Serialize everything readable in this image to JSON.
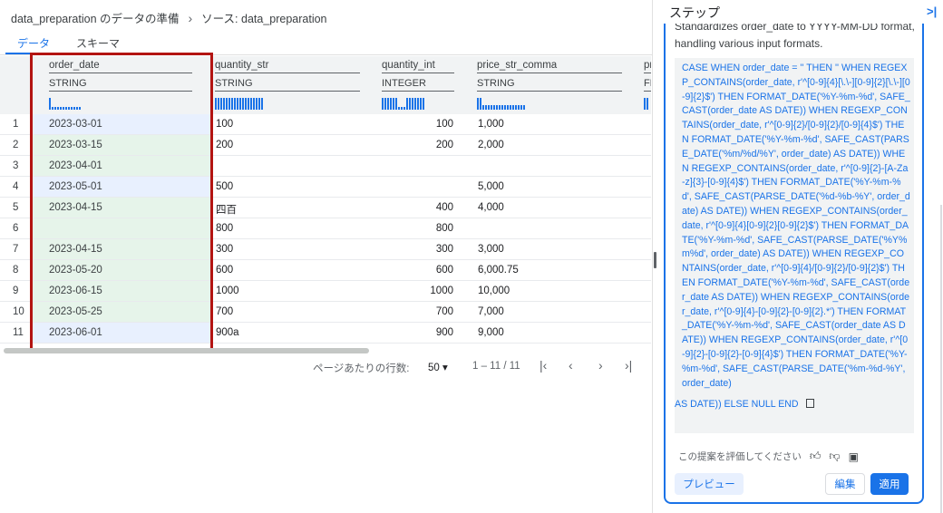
{
  "breadcrumb": {
    "item1": "data_preparation のデータの準備",
    "item2": "ソース: data_preparation"
  },
  "tabs": [
    "データ",
    "スキーマ"
  ],
  "columns": [
    {
      "name": "order_date",
      "type": "STRING"
    },
    {
      "name": "quantity_str",
      "type": "STRING"
    },
    {
      "name": "quantity_int",
      "type": "INTEGER"
    },
    {
      "name": "price_str_comma",
      "type": "STRING"
    },
    {
      "name": "pr",
      "type": "FL"
    }
  ],
  "rows": [
    {
      "n": "1",
      "order_date": "2023-03-01",
      "quantity_str": "100",
      "quantity_int": "100",
      "price_str_comma": "1,000",
      "hl": "b"
    },
    {
      "n": "2",
      "order_date": "2023-03-15",
      "quantity_str": "200",
      "quantity_int": "200",
      "price_str_comma": "2,000",
      "hl": "g"
    },
    {
      "n": "3",
      "order_date": "2023-04-01",
      "quantity_str": "",
      "quantity_int": "",
      "price_str_comma": "",
      "hl": "g"
    },
    {
      "n": "4",
      "order_date": "2023-05-01",
      "quantity_str": "500",
      "quantity_int": "",
      "price_str_comma": "5,000",
      "hl": "b"
    },
    {
      "n": "5",
      "order_date": "2023-04-15",
      "quantity_str": "四百",
      "quantity_int": "400",
      "price_str_comma": "4,000",
      "hl": "g"
    },
    {
      "n": "6",
      "order_date": "",
      "quantity_str": "800",
      "quantity_int": "800",
      "price_str_comma": "",
      "hl": "g"
    },
    {
      "n": "7",
      "order_date": "2023-04-15",
      "quantity_str": "300",
      "quantity_int": "300",
      "price_str_comma": "3,000",
      "hl": "g"
    },
    {
      "n": "8",
      "order_date": "2023-05-20",
      "quantity_str": "600",
      "quantity_int": "600",
      "price_str_comma": "6,000.75",
      "hl": "g"
    },
    {
      "n": "9",
      "order_date": "2023-06-15",
      "quantity_str": "1000",
      "quantity_int": "1000",
      "price_str_comma": "10,000",
      "hl": "g"
    },
    {
      "n": "10",
      "order_date": "2023-05-25",
      "quantity_str": "700",
      "quantity_int": "700",
      "price_str_comma": "7,000",
      "hl": "g"
    },
    {
      "n": "11",
      "order_date": "2023-06-01",
      "quantity_str": "900a",
      "quantity_int": "900",
      "price_str_comma": "9,000",
      "hl": "b"
    }
  ],
  "pager": {
    "rows_per_page_label": "ページあたりの行数:",
    "rows_per_page": "50",
    "range": "1 – 11 / 11"
  },
  "steps_panel": {
    "title": "ステップ",
    "description": "Standardizes order_date to YYYY-MM-DD format, handling various input formats.",
    "code": "CASE WHEN order_date = '' THEN '' WHEN REGEXP_CONTAINS(order_date, r'^[0-9]{4}[\\.\\-][0-9]{2}[\\.\\-][0-9]{2}$') THEN FORMAT_DATE('%Y-%m-%d', SAFE_CAST(order_date AS DATE)) WHEN REGEXP_CONTAINS(order_date, r'^[0-9]{2}/[0-9]{2}/[0-9]{4}$') THEN FORMAT_DATE('%Y-%m-%d', SAFE_CAST(PARSE_DATE('%m/%d/%Y', order_date) AS DATE)) WHEN REGEXP_CONTAINS(order_date, r'^[0-9]{2}-[A-Za-z]{3}-[0-9]{4}$') THEN FORMAT_DATE('%Y-%m-%d', SAFE_CAST(PARSE_DATE('%d-%b-%Y', order_date) AS DATE)) WHEN REGEXP_CONTAINS(order_date, r'^[0-9]{4}[0-9]{2}[0-9]{2}$') THEN FORMAT_DATE('%Y-%m-%d', SAFE_CAST(PARSE_DATE('%Y%m%d', order_date) AS DATE)) WHEN REGEXP_CONTAINS(order_date, r'^[0-9]{4}/[0-9]{2}/[0-9]{2}$') THEN FORMAT_DATE('%Y-%m-%d', SAFE_CAST(order_date AS DATE)) WHEN REGEXP_CONTAINS(order_date, r'^[0-9]{4}-[0-9]{2}-[0-9]{2}.*') THEN FORMAT_DATE('%Y-%m-%d', SAFE_CAST(order_date AS DATE)) WHEN REGEXP_CONTAINS(order_date, r'^[0-9]{2}-[0-9]{2}-[0-9]{4}$') THEN FORMAT_DATE('%Y-%m-%d', SAFE_CAST(PARSE_DATE('%m-%d-%Y', order_date)",
    "code_tail": "AS DATE)) ELSE NULL END",
    "rate_label": "この提案を評価してください",
    "preview_label": "プレビュー",
    "edit_label": "編集",
    "apply_label": "適用"
  }
}
